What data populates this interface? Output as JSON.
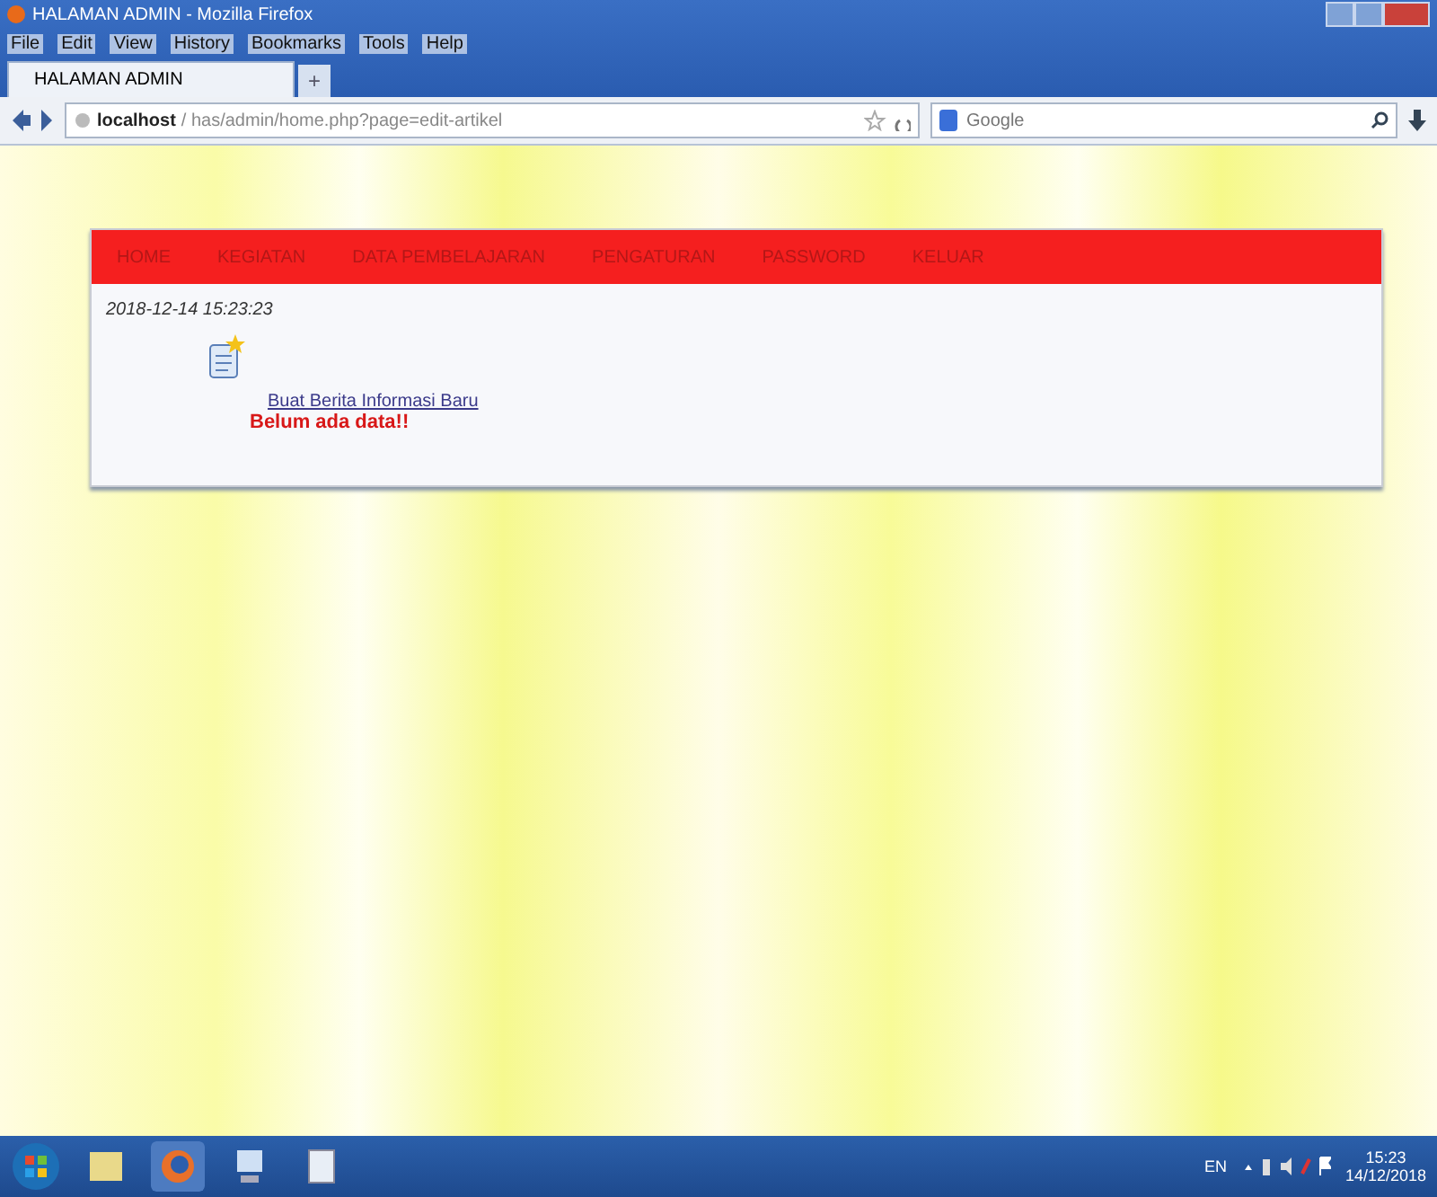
{
  "window": {
    "title": "HALAMAN ADMIN - Mozilla Firefox"
  },
  "menu": [
    "File",
    "Edit",
    "View",
    "History",
    "Bookmarks",
    "Tools",
    "Help"
  ],
  "tabs": [
    {
      "label": "HALAMAN ADMIN",
      "selected": true
    }
  ],
  "new_tab": "+",
  "address": {
    "host": "localhost",
    "path": "/ has/admin/home.php?page=edit-artikel"
  },
  "search": {
    "placeholder": "Google"
  },
  "nav": [
    "HOME",
    "KEGIATAN",
    "DATA PEMBELAJARAN",
    "PENGATURAN",
    "PASSWORD",
    "KELUAR"
  ],
  "timestamp": "2018-12-14 15:23:23",
  "new_link": "Buat Berita Informasi Baru",
  "empty_message": "Belum ada data!!",
  "tray": {
    "language": "EN",
    "time": "15:23",
    "date": "14/12/2018"
  }
}
